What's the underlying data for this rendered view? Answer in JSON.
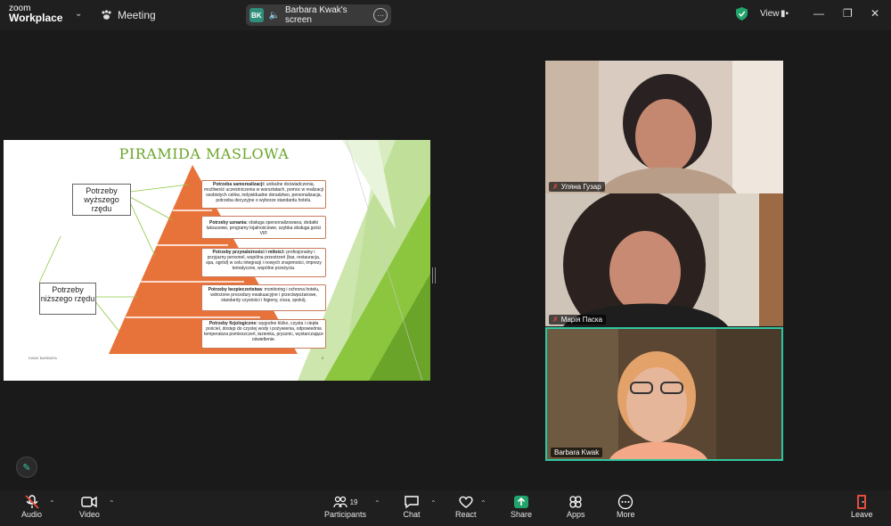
{
  "app": {
    "logo_top": "zoom",
    "logo_bottom": "Workplace",
    "meeting_label": "Meeting"
  },
  "share_banner": {
    "initials": "BK",
    "label": "Barbara Kwak's screen"
  },
  "view_label": "View",
  "slide": {
    "title": "PIRAMIDA MASLOWA",
    "left_boxes": [
      "Potrzeby wyższego rzędu",
      "Potrzeby niższego rzędu"
    ],
    "levels": [
      {
        "head": "Potrzeba samorealizacji:",
        "text": " unikalne doświadczenia, możliwość uczestniczenia w warsztatach, pomoc w realizacji osobistych celów, indywidualne doradztwo, personalizacja, potrzeba decyzyjne o wyborze standardu hotelu."
      },
      {
        "head": "Potrzeby uznania:",
        "text": " obsługa spersonalizowana, dodatki luksusowe, programy lojalnościowe, szybka obsługa gości VIP."
      },
      {
        "head": "Potrzeby przynależności i miłości:",
        "text": " profesjonalny i przyjazny personel, wspólna przestrzeń (bar, restauracja, spa, ogród) w celu integracji i nowych znajomości, imprezy tematyczne, wspólne przeżycia."
      },
      {
        "head": "Potrzeby bezpieczeństwa",
        "text": ": monitoring i ochrona hotelu, wdrożone procedury ewakuacyjne i przeciwpożarowe, standardy czystości i higieny, cisza, spokój."
      },
      {
        "head": "Potrzeby fizjologiczne:",
        "text": " wygodne łóżko, czysta i ciepła pościel, dostęp do czystej wody i pożywienia, odpowiednia temperatura pomieszczeń, łazienka, prysznic, wystarczające oświetlenie."
      }
    ],
    "footer_left": "KWAK BARBARA",
    "footer_right": "5"
  },
  "participants": [
    {
      "name": "Уляна Гузар",
      "muted": true
    },
    {
      "name": "Марія Паска",
      "muted": true
    },
    {
      "name": "Barbara Kwak",
      "muted": false
    }
  ],
  "toolbar": {
    "audio": "Audio",
    "video": "Video",
    "participants": "Participants",
    "participants_count": "19",
    "chat": "Chat",
    "react": "React",
    "share": "Share",
    "apps": "Apps",
    "more": "More",
    "leave": "Leave"
  },
  "colors": {
    "accent_green": "#22a36b",
    "pyramid": "#e8733a",
    "slide_green": "#8cc63f",
    "active_border": "#2fc7a1"
  }
}
